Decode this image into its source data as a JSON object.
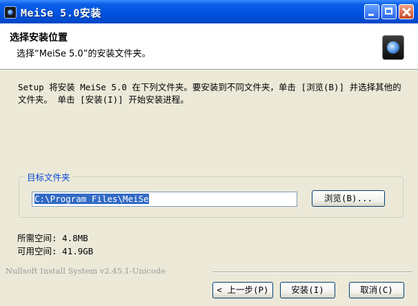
{
  "window": {
    "title": "MeiSe 5.0安装"
  },
  "header": {
    "title": "选择安装位置",
    "subtitle": "选择“MeiSe 5.0”的安装文件夹。"
  },
  "description": "Setup 将安装 MeiSe 5.0 在下列文件夹。要安装到不同文件夹，单击 [浏览(B)] 并选择其他的文件夹。 单击 [安装(I)] 开始安装进程。",
  "destination": {
    "group_label": "目标文件夹",
    "path_value": "C:\\Program Files\\MeiSe",
    "browse_label": "浏览(B)..."
  },
  "space": {
    "required": "所需空间: 4.8MB",
    "available": "可用空间: 41.9GB"
  },
  "branding": "Nullsoft Install System v2.45.1-Unicode",
  "buttons": {
    "back": "< 上一步(P)",
    "install": "安装(I)",
    "cancel": "取消(C)"
  }
}
